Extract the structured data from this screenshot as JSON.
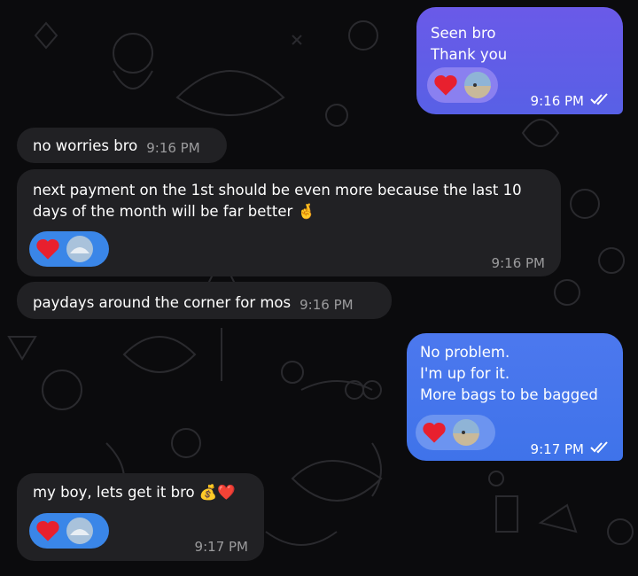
{
  "messages": [
    {
      "id": "m1",
      "side": "out",
      "text": "Seen bro\nThank you",
      "time": "9:16 PM",
      "reactions": [
        "heart-icon",
        "avatar"
      ]
    },
    {
      "id": "m2",
      "side": "in",
      "text": "no worries bro",
      "time": "9:16 PM"
    },
    {
      "id": "m3",
      "side": "in",
      "text": "next payment on the 1st should be even more because the last 10\ndays of the month will be far better",
      "emoji": "🤞",
      "time": "9:16 PM",
      "reactions": [
        "heart-icon",
        "avatar"
      ]
    },
    {
      "id": "m4",
      "side": "in",
      "text": "paydays around the corner for mos",
      "time": "9:16 PM"
    },
    {
      "id": "m5",
      "side": "out",
      "text": "No problem.\nI'm up for it.\nMore bags to be bagged",
      "time": "9:17 PM",
      "reactions": [
        "heart-icon",
        "avatar"
      ]
    },
    {
      "id": "m6",
      "side": "in",
      "text": "my boy, lets get it bro",
      "emoji": "💰❤️",
      "time": "9:17 PM",
      "reactions": [
        "heart-icon",
        "avatar"
      ]
    }
  ],
  "colors": {
    "background": "#0b0b0d",
    "incoming_bubble": "#212124",
    "outgoing_violet": "#5f5ce8",
    "outgoing_blue": "#4276ec",
    "heart": "#e8202e"
  }
}
